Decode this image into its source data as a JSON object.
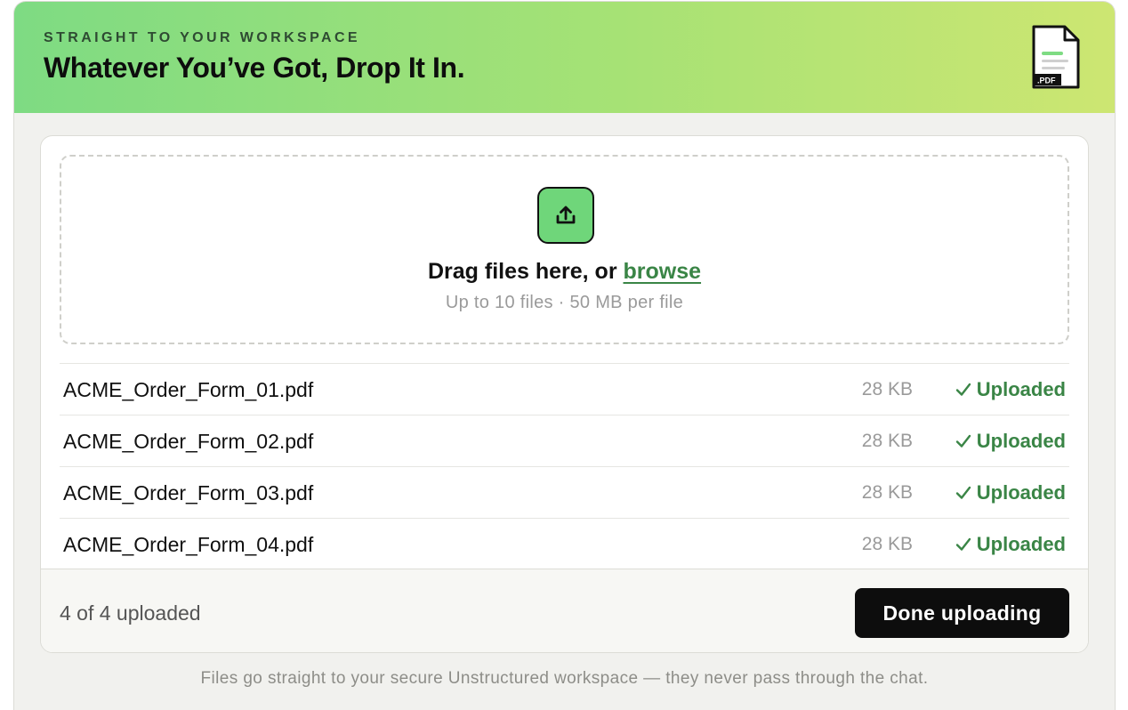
{
  "header": {
    "eyebrow": "STRAIGHT TO YOUR WORKSPACE",
    "title": "Whatever You’ve Got, Drop It In.",
    "icon": "pdf-file-icon",
    "icon_label": ".PDF"
  },
  "dropzone": {
    "icon": "upload-icon",
    "prompt": "Drag files here, or ",
    "browse_label": "browse",
    "hint": "Up to 10 files · 50 MB per file"
  },
  "files": [
    {
      "name": "ACME_Order_Form_01.pdf",
      "size": "28 KB",
      "status": "Uploaded"
    },
    {
      "name": "ACME_Order_Form_02.pdf",
      "size": "28 KB",
      "status": "Uploaded"
    },
    {
      "name": "ACME_Order_Form_03.pdf",
      "size": "28 KB",
      "status": "Uploaded"
    },
    {
      "name": "ACME_Order_Form_04.pdf",
      "size": "28 KB",
      "status": "Uploaded"
    }
  ],
  "footer": {
    "count": "4 of 4 uploaded",
    "done_label": "Done uploading"
  },
  "disclaimer": "Files go straight to your secure Unstructured workspace — they never pass through the chat.",
  "colors": {
    "accent_green": "#3a8546",
    "upload_button": "#6fd67a",
    "header_gradient_start": "#7edb83",
    "header_gradient_end": "#cde672",
    "primary_button": "#0d0d0d"
  }
}
